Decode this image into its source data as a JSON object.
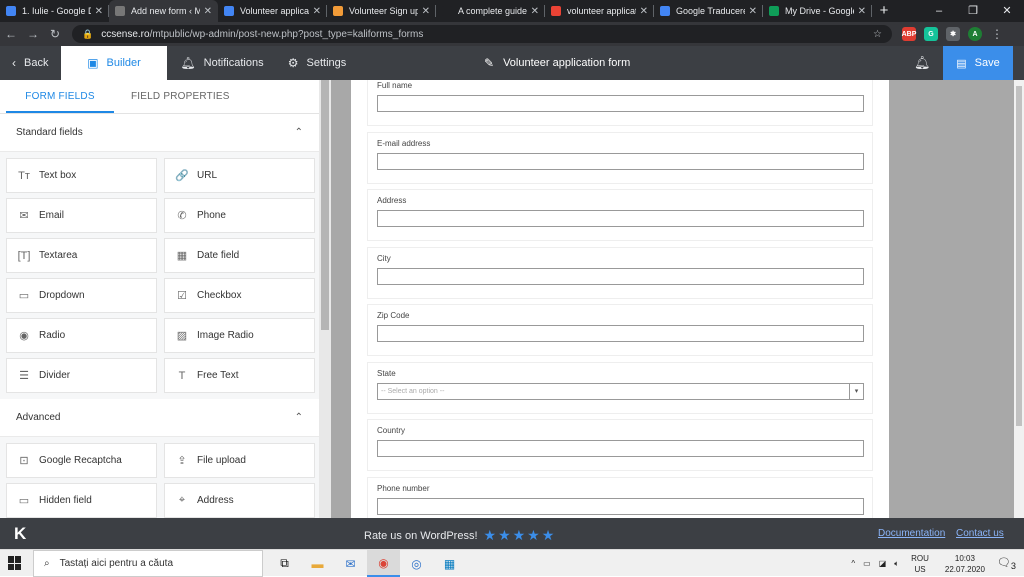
{
  "browser": {
    "tabs": [
      {
        "label": "1. Iulie - Google D",
        "favicon": "google-drive-icon",
        "color": "#4285f4"
      },
      {
        "label": "Add new form ‹ M",
        "favicon": "wordpress-icon",
        "color": "#777",
        "active": true
      },
      {
        "label": "Volunteer applicat",
        "favicon": "google-docs-icon",
        "color": "#4285f4"
      },
      {
        "label": "Volunteer Sign up",
        "favicon": "form-icon",
        "color": "#f29b38"
      },
      {
        "label": "A complete guide",
        "favicon": "kaliforms-icon",
        "color": "#202124"
      },
      {
        "label": "volunteer applicat",
        "favicon": "google-icon",
        "color": "#ea4335"
      },
      {
        "label": "Google Traducere",
        "favicon": "translate-icon",
        "color": "#4285f4"
      },
      {
        "label": "My Drive - Google",
        "favicon": "google-drive-icon",
        "color": "#0f9d58"
      }
    ],
    "url_domain": "ccsense.ro",
    "url_path": "/mtpublic/wp-admin/post-new.php?post_type=kaliforms_forms",
    "extensions": [
      {
        "name": "abp-icon",
        "text": "ABP",
        "color": "#e03c31"
      },
      {
        "name": "grammarly-icon",
        "text": "G",
        "color": "#15c39a"
      },
      {
        "name": "puzzle-icon",
        "text": "✱",
        "color": "#5f6368"
      },
      {
        "name": "avatar",
        "text": "A",
        "color": "#1e7e34"
      }
    ]
  },
  "header": {
    "back_label": "Back",
    "builder_label": "Builder",
    "notifications_label": "Notifications",
    "settings_label": "Settings",
    "form_title": "Volunteer application form",
    "save_label": "Save"
  },
  "panel": {
    "tabs": [
      "FORM FIELDS",
      "FIELD PROPERTIES"
    ],
    "standard_title": "Standard fields",
    "standard_fields": [
      {
        "label": "Text box",
        "icon": "text-box-icon",
        "glyph": "Tт"
      },
      {
        "label": "URL",
        "icon": "link-icon",
        "glyph": "🔗"
      },
      {
        "label": "Email",
        "icon": "envelope-icon",
        "glyph": "✉"
      },
      {
        "label": "Phone",
        "icon": "phone-icon",
        "glyph": "✆"
      },
      {
        "label": "Textarea",
        "icon": "textarea-icon",
        "glyph": "[T]"
      },
      {
        "label": "Date field",
        "icon": "calendar-icon",
        "glyph": "▦"
      },
      {
        "label": "Dropdown",
        "icon": "dropdown-icon",
        "glyph": "▭"
      },
      {
        "label": "Checkbox",
        "icon": "checkbox-icon",
        "glyph": "☑"
      },
      {
        "label": "Radio",
        "icon": "radio-icon",
        "glyph": "◉"
      },
      {
        "label": "Image Radio",
        "icon": "image-radio-icon",
        "glyph": "▨"
      },
      {
        "label": "Divider",
        "icon": "divider-icon",
        "glyph": "☰"
      },
      {
        "label": "Free Text",
        "icon": "free-text-icon",
        "glyph": "T"
      }
    ],
    "advanced_title": "Advanced",
    "advanced_fields": [
      {
        "label": "Google Recaptcha",
        "icon": "recaptcha-icon",
        "glyph": "⊡"
      },
      {
        "label": "File upload",
        "icon": "upload-icon",
        "glyph": "⇪"
      },
      {
        "label": "Hidden field",
        "icon": "hidden-field-icon",
        "glyph": "▭"
      },
      {
        "label": "Address",
        "icon": "location-pin-icon",
        "glyph": "⌖"
      }
    ]
  },
  "form": {
    "fields": [
      {
        "label": "Full name",
        "type": "text",
        "value": ""
      },
      {
        "label": "E-mail address",
        "type": "text",
        "value": ""
      },
      {
        "label": "Address",
        "type": "text",
        "value": ""
      },
      {
        "label": "City",
        "type": "text",
        "value": ""
      },
      {
        "label": "Zip Code",
        "type": "text",
        "value": ""
      },
      {
        "label": "State",
        "type": "select",
        "value": "-- Select an option --"
      },
      {
        "label": "Country",
        "type": "text",
        "value": ""
      },
      {
        "label": "Phone number",
        "type": "text",
        "value": ""
      }
    ]
  },
  "footer": {
    "logo": "K",
    "rate_text": "Rate us on WordPress!",
    "stars": "★★★★★",
    "documentation_label": "Documentation",
    "contact_label": "Contact us"
  },
  "taskbar": {
    "search_placeholder": "Tastați aici pentru a căuta",
    "language": "ROU",
    "layout": "US",
    "time": "10:03",
    "date": "22.07.2020",
    "notification_count": "3"
  }
}
